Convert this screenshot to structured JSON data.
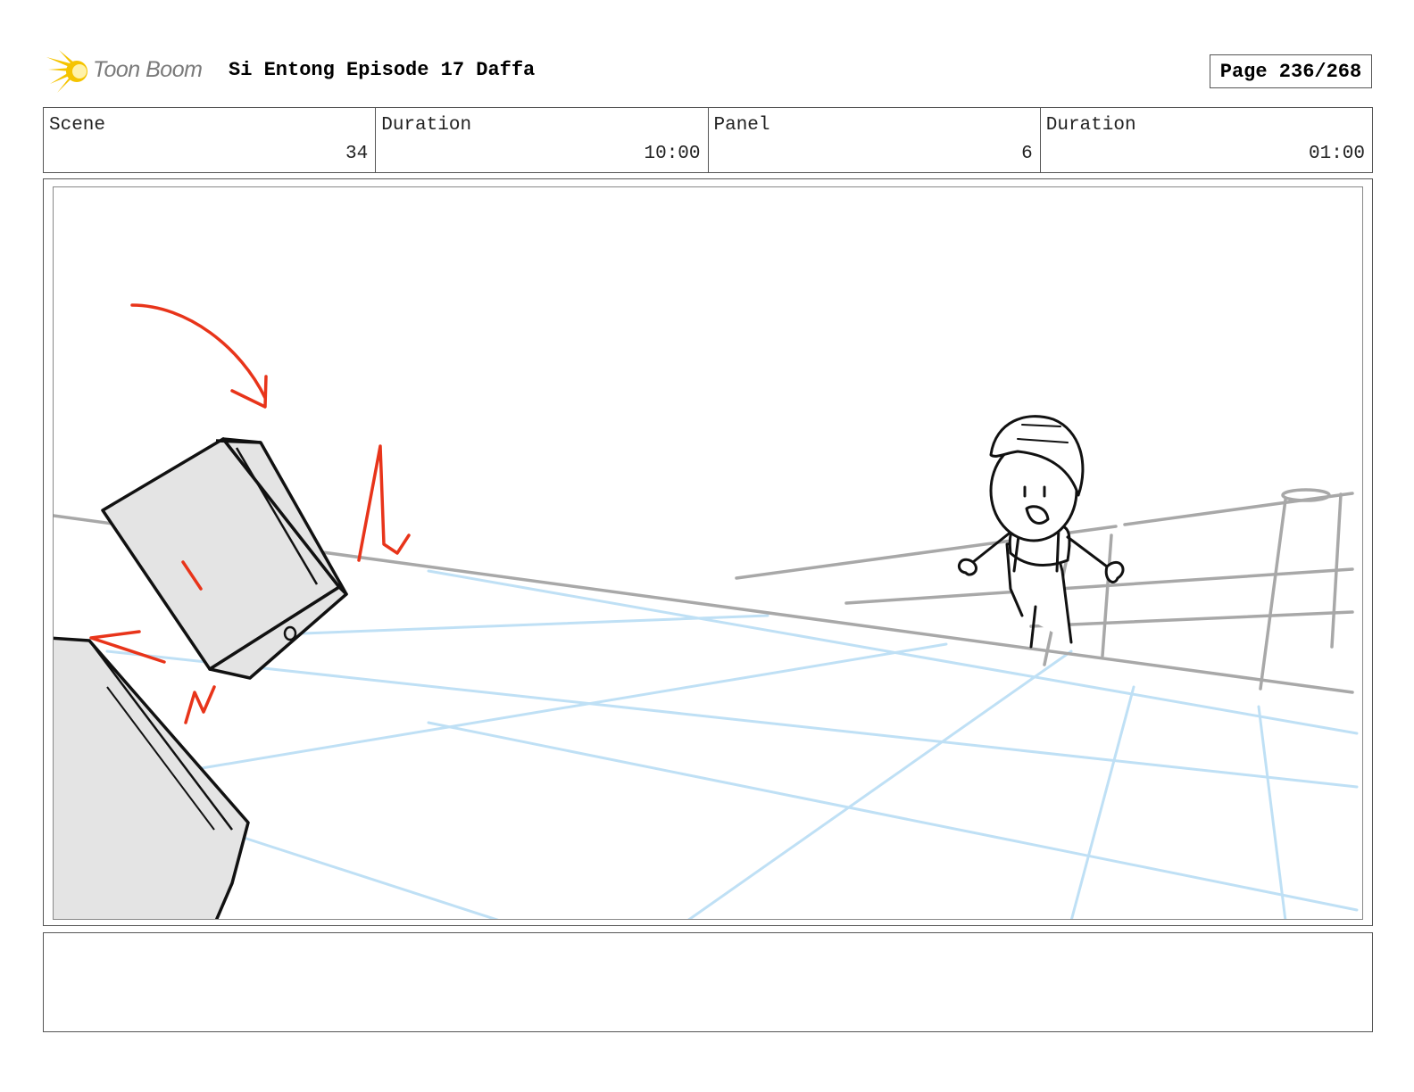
{
  "header": {
    "logo_text": "Toon Boom",
    "title": "Si Entong Episode 17 Daffa",
    "page_label": "Page 236/268"
  },
  "info": {
    "scene_label": "Scene",
    "scene_value": "34",
    "scene_duration_label": "Duration",
    "scene_duration_value": "10:00",
    "panel_label": "Panel",
    "panel_value": "6",
    "panel_duration_label": "Duration",
    "panel_duration_value": "01:00"
  },
  "notes": {
    "text": ""
  },
  "colors": {
    "border": "#555555",
    "sketch_red": "#e8341a",
    "guide_blue": "#bfe0f5",
    "logo_yellow": "#f5c400"
  },
  "icons": {
    "logo": "sunburst-icon"
  }
}
